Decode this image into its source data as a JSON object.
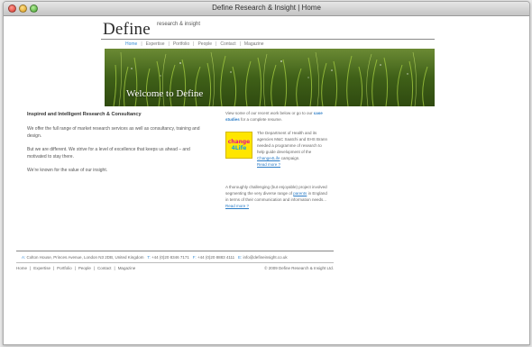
{
  "window": {
    "title": "Define Research & Insight | Home"
  },
  "site": {
    "logo_word": "Define",
    "logo_tagline": "research & insight",
    "nav": [
      "Home",
      "Expertise",
      "Portfolio",
      "People",
      "Contact",
      "Magazine"
    ],
    "banner_text": "Welcome to Define"
  },
  "main": {
    "heading": "Inspired and Intelligent Research & Consultancy",
    "p1": "We offer the full range of market research services as well as consultancy, training and design.",
    "p2": "But we are different. We strive for a level of excellence that keeps us ahead – and motivated to stay there.",
    "p3": "We’re known for the value of our insight."
  },
  "sidebar": {
    "intro_before": "View some of our recent work below or go to our ",
    "intro_link": "case studies",
    "intro_after": " for a complete resume.",
    "logo_line1": "change",
    "logo_line2": "4Life",
    "case1_text": "The Department of Health and its agencies M&C Saatchi and EHS Brann needed a programme of research to help guide development of the ",
    "case1_link": "Change4Life",
    "case1_after": " campaign.",
    "case1_more": "Read more ?",
    "case2_text": "A thoroughly challenging (but enjoyable) project involved segmenting the very diverse range of ",
    "case2_link": "parents",
    "case2_after": " in England in terms of their communication and information needs... ",
    "case2_more": "Read more ?"
  },
  "footer": {
    "address_key": "A:",
    "address": "Colton House, Princes Avenue, London N3 2DB, United Kingdom",
    "tel_key": "T:",
    "tel": "+44 (0)20 8346 7171",
    "fax_key": "F:",
    "fax": "+44 (0)20 8883 4111",
    "email_key": "E:",
    "email": "info@defineinsight.co.uk",
    "nav": [
      "Home",
      "Expertise",
      "Portfolio",
      "People",
      "Contact",
      "Magazine"
    ],
    "copyright": "© 2009 Define Research & Insight Ltd."
  },
  "colors": {
    "link": "#2b7cc6",
    "nav_active": "#3a8fd6",
    "c4l_yellow": "#ffe600"
  }
}
